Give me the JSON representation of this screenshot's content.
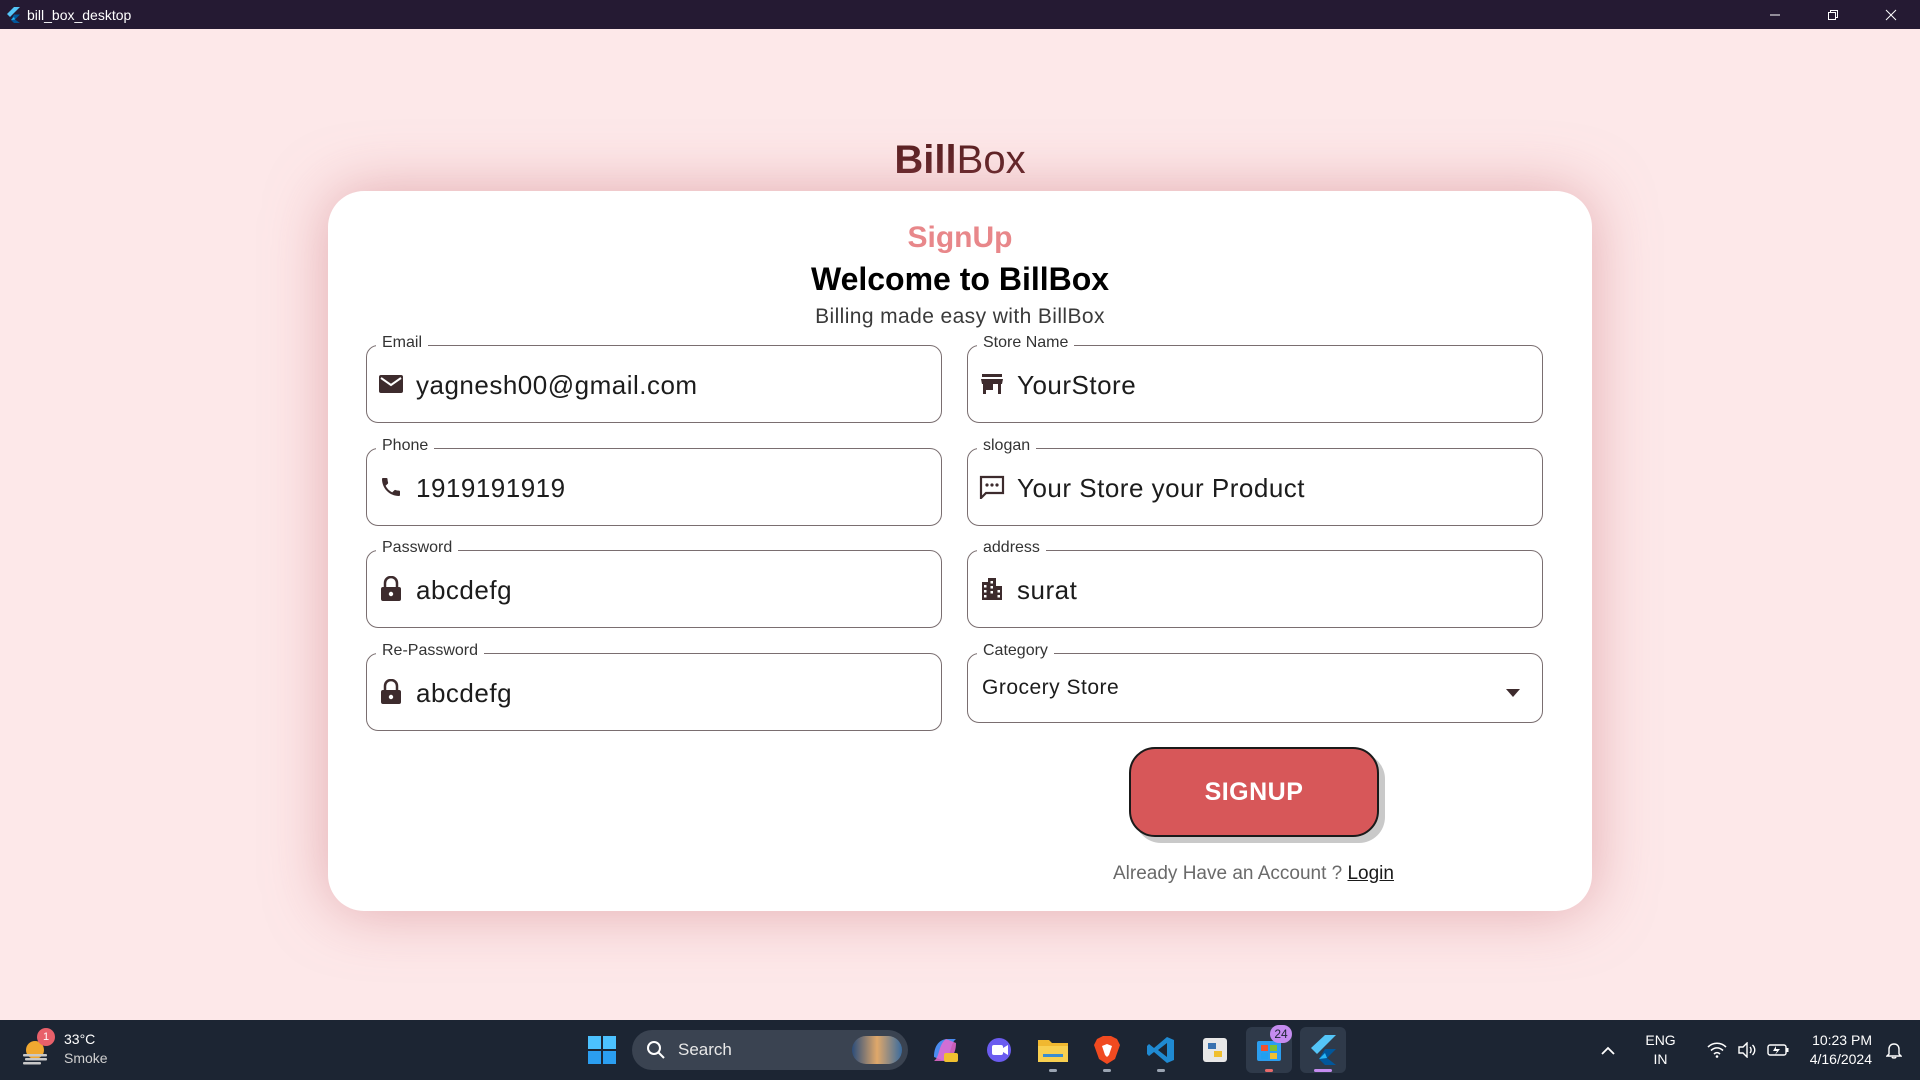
{
  "window": {
    "title": "bill_box_desktop",
    "icon": "flutter-icon"
  },
  "brand": {
    "bold": "Bill",
    "light": "Box"
  },
  "form": {
    "heading": "SignUp",
    "welcome": "Welcome to BillBox",
    "tagline": "Billing made easy with BillBox",
    "fields": {
      "email": {
        "label": "Email",
        "value": "yagnesh00@gmail.com",
        "icon": "mail-icon"
      },
      "store_name": {
        "label": "Store Name",
        "value": "YourStore",
        "icon": "store-icon"
      },
      "phone": {
        "label": "Phone",
        "value": "1919191919",
        "icon": "phone-icon"
      },
      "slogan": {
        "label": "slogan",
        "value": "Your Store your Product",
        "icon": "chat-icon"
      },
      "password": {
        "label": "Password",
        "value": "abcdefg",
        "icon": "lock-icon"
      },
      "address": {
        "label": "address",
        "value": "surat",
        "icon": "building-icon"
      },
      "re_password": {
        "label": "Re-Password",
        "value": "abcdefg",
        "icon": "lock-icon"
      },
      "category": {
        "label": "Category",
        "value": "Grocery Store",
        "icon": "dropdown-caret-icon"
      }
    },
    "submit_label": "SIGNUP",
    "already_text": "Already Have an Account ? ",
    "login_link": "Login"
  },
  "colors": {
    "background": "#fde8e9",
    "brand": "#5a1f22",
    "heading_accent": "#e8878a",
    "button": "#d75759"
  },
  "taskbar": {
    "weather": {
      "badge": "1",
      "temp": "33°C",
      "condition": "Smoke"
    },
    "search_placeholder": "Search",
    "apps": [
      {
        "name": "copilot-icon"
      },
      {
        "name": "meet-icon"
      },
      {
        "name": "file-explorer-icon"
      },
      {
        "name": "brave-icon"
      },
      {
        "name": "vscode-icon"
      },
      {
        "name": "python-icon"
      },
      {
        "name": "store-app-icon",
        "badge": "24"
      },
      {
        "name": "flutter-app-icon"
      }
    ],
    "language": {
      "line1": "ENG",
      "line2": "IN"
    },
    "clock": {
      "time": "10:23 PM",
      "date": "4/16/2024"
    }
  }
}
